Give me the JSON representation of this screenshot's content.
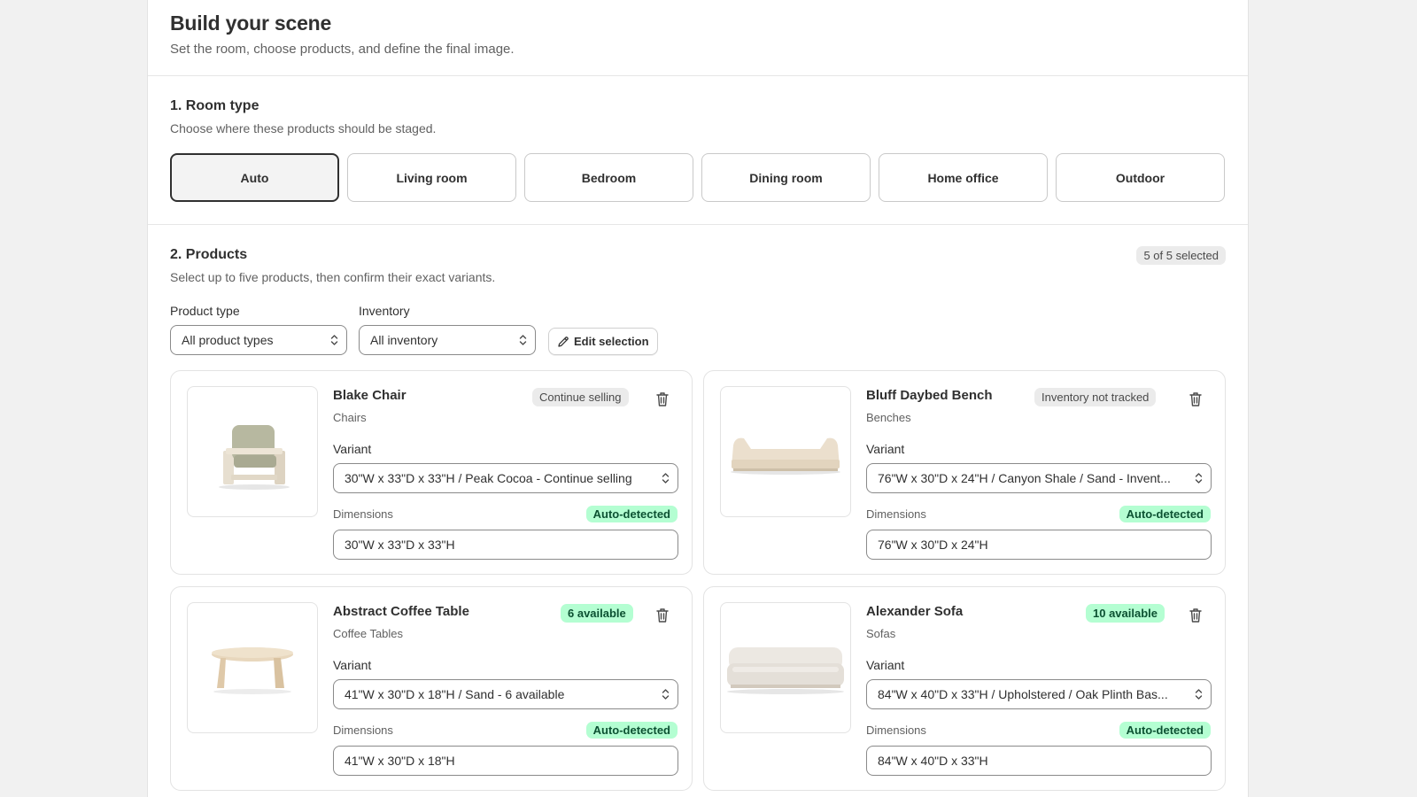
{
  "header": {
    "title": "Build your scene",
    "subtitle": "Set the room, choose products, and define the final image."
  },
  "room_type": {
    "title": "1. Room type",
    "subtitle": "Choose where these products should be staged.",
    "selected": "Auto",
    "options": [
      "Auto",
      "Living room",
      "Bedroom",
      "Dining room",
      "Home office",
      "Outdoor"
    ]
  },
  "products_section": {
    "title": "2. Products",
    "subtitle": "Select up to five products, then confirm their exact variants.",
    "selected_count": "5 of 5 selected",
    "filters": {
      "product_type_label": "Product type",
      "product_type_value": "All product types",
      "inventory_label": "Inventory",
      "inventory_value": "All inventory",
      "edit_selection_label": "Edit selection"
    },
    "variant_label": "Variant",
    "dimensions_label": "Dimensions",
    "auto_detected_label": "Auto-detected",
    "items": [
      {
        "name": "Blake Chair",
        "category": "Chairs",
        "status": "Continue selling",
        "status_style": "neutral",
        "variant": "30\"W x 33\"D x 33\"H / Peak Cocoa - Continue selling",
        "dimensions": "30\"W x 33\"D x 33\"H",
        "image_icon": "chair-icon"
      },
      {
        "name": "Bluff Daybed Bench",
        "category": "Benches",
        "status": "Inventory not tracked",
        "status_style": "neutral",
        "variant": "76\"W x 30\"D x 24\"H / Canyon Shale / Sand - Invent...",
        "dimensions": "76\"W x 30\"D x 24\"H",
        "image_icon": "bench-icon"
      },
      {
        "name": "Abstract Coffee Table",
        "category": "Coffee Tables",
        "status": "6 available",
        "status_style": "success",
        "variant": "41\"W x 30\"D x 18\"H / Sand - 6 available",
        "dimensions": "41\"W x 30\"D x 18\"H",
        "image_icon": "table-icon"
      },
      {
        "name": "Alexander Sofa",
        "category": "Sofas",
        "status": "10 available",
        "status_style": "success",
        "variant": "84\"W x 40\"D x 33\"H / Upholstered / Oak Plinth Bas...",
        "dimensions": "84\"W x 40\"D x 33\"H",
        "image_icon": "sofa-icon"
      }
    ]
  },
  "colors": {
    "page_bg": "#f1f1f1",
    "text": "#303030",
    "muted": "#616161",
    "success_bg": "#b4fed2",
    "success_text": "#0c5132"
  }
}
